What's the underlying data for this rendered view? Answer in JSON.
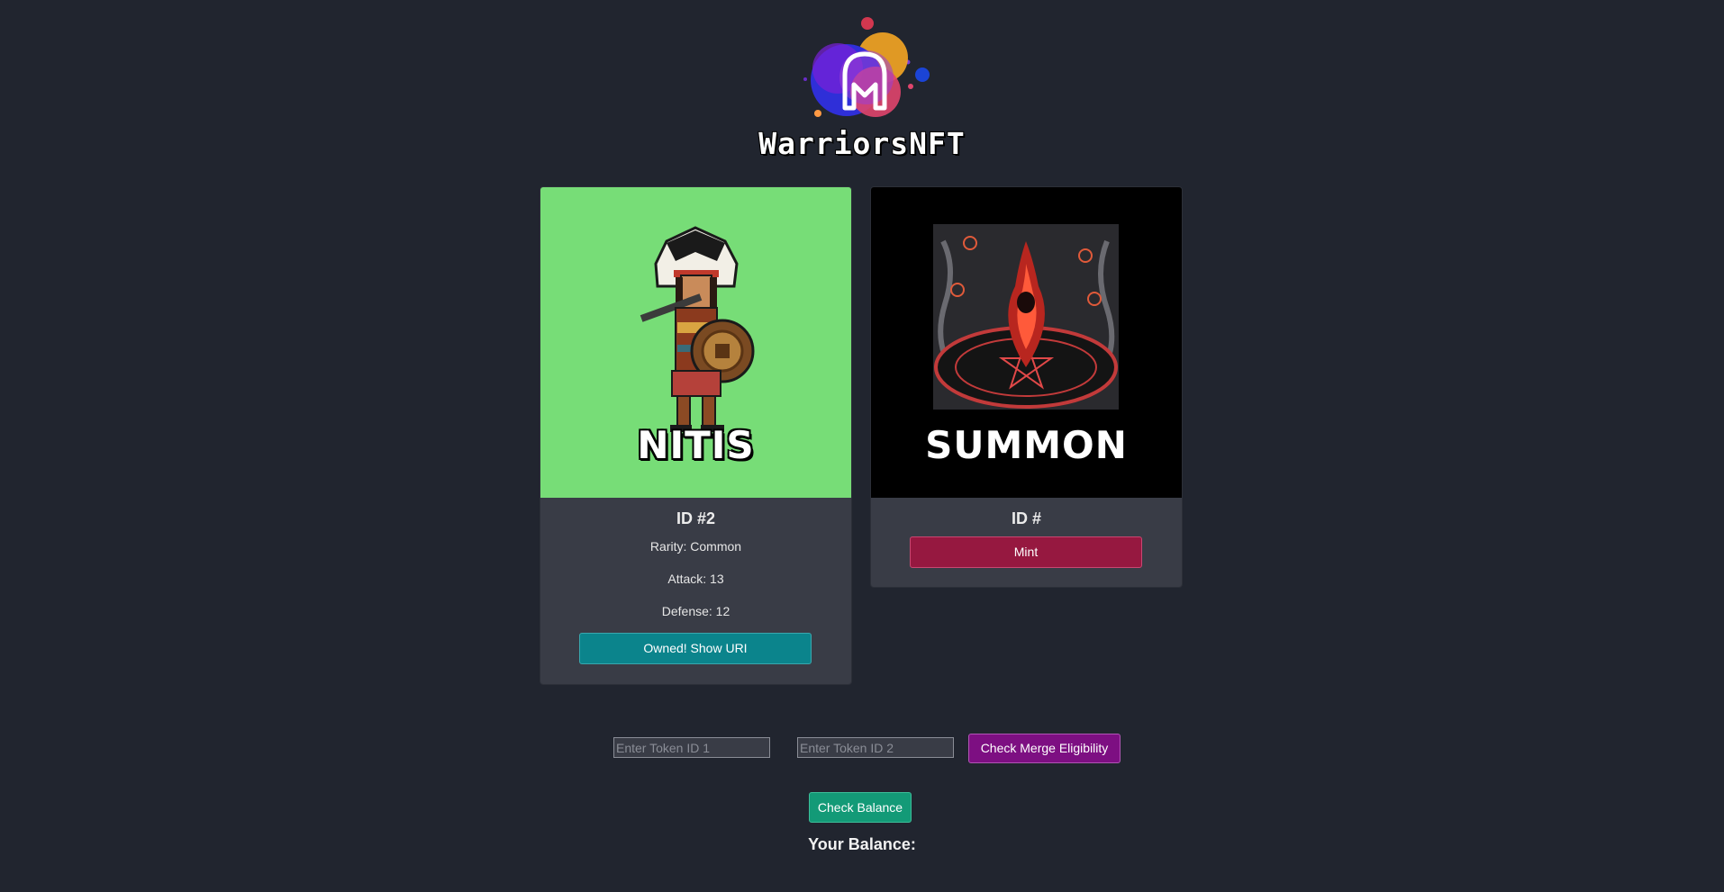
{
  "header": {
    "brand": "WarriorsNFT"
  },
  "cards": [
    {
      "art_title": "NITIS",
      "id_label": "ID #2",
      "rarity": "Rarity: Common",
      "attack": "Attack: 13",
      "defense": "Defense: 12",
      "button_label": "Owned! Show URI",
      "art_color": "#77dd77"
    },
    {
      "art_title": "SUMMON",
      "id_label": "ID #",
      "button_label": "Mint",
      "art_color": "#000000"
    }
  ],
  "merge": {
    "token1_placeholder": "Enter Token ID 1",
    "token2_placeholder": "Enter Token ID 2",
    "button_label": "Check Merge Eligibility"
  },
  "balance": {
    "button_label": "Check Balance",
    "label": "Your Balance:"
  },
  "colors": {
    "background": "#21252f",
    "card": "#393c46",
    "teal_button": "#0b848c",
    "mint_button": "#961840",
    "merge_button": "#7d0f82",
    "balance_button": "#139a77"
  }
}
